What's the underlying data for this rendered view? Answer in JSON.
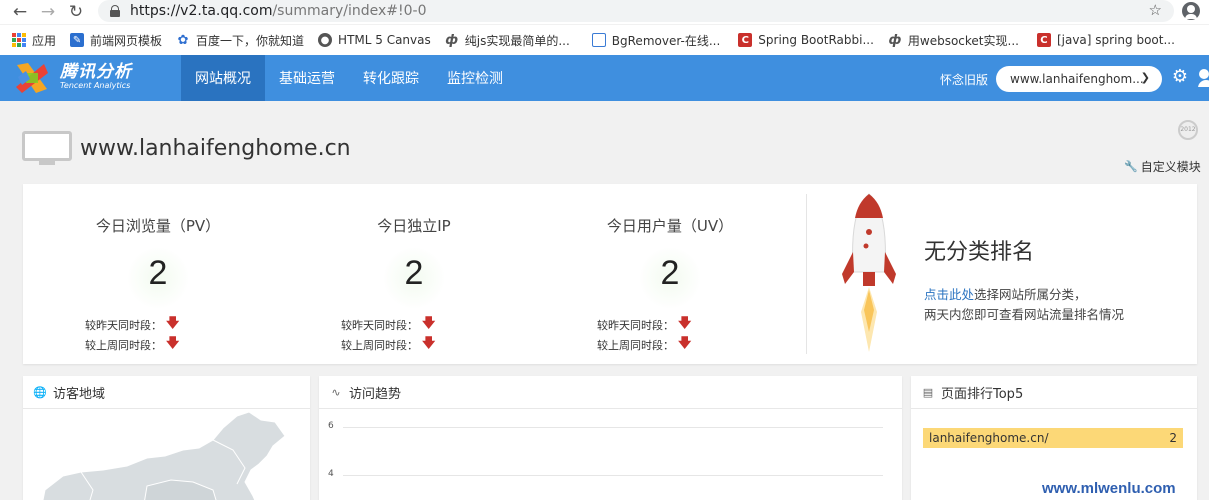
{
  "browser": {
    "url_main": "https://v2.ta.qq.com",
    "url_path": "/summary/index#!0-0",
    "bookmarks": [
      {
        "label": "应用",
        "icon": "apps-icon"
      },
      {
        "label": "前端网页模板",
        "icon": "page-icon"
      },
      {
        "label": "百度一下，你就知道",
        "icon": "baidu-paw-icon"
      },
      {
        "label": "HTML 5 Canvas",
        "icon": "globe-icon"
      },
      {
        "label": "纯js实现最简单的...",
        "icon": "v-icon"
      },
      {
        "label": "BgRemover-在线...",
        "icon": "box-icon"
      },
      {
        "label": "Spring BootRabbi...",
        "icon": "c-icon"
      },
      {
        "label": "用websocket实现...",
        "icon": "v-icon"
      },
      {
        "label": "[java] spring boot...",
        "icon": "c-icon"
      }
    ]
  },
  "header": {
    "logo_cn": "腾讯分析",
    "logo_en": "Tencent Analytics",
    "tabs": [
      {
        "label": "网站概况",
        "active": true
      },
      {
        "label": "基础运营",
        "active": false
      },
      {
        "label": "转化跟踪",
        "active": false
      },
      {
        "label": "监控检测",
        "active": false
      }
    ],
    "old_version_link": "怀念旧版",
    "site_select": "www.lanhaifenghom...",
    "accent_color": "#3f8fdf"
  },
  "site": {
    "name": "www.lanhaifenghome.cn",
    "custom_module": "自定义模块"
  },
  "stats": [
    {
      "label": "今日浏览量（PV）",
      "value": "2",
      "compare_yesterday": "较昨天同时段：",
      "compare_lastweek": "较上周同时段："
    },
    {
      "label": "今日独立IP",
      "value": "2",
      "compare_yesterday": "较昨天同时段：",
      "compare_lastweek": "较上周同时段："
    },
    {
      "label": "今日用户量（UV）",
      "value": "2",
      "compare_yesterday": "较昨天同时段：",
      "compare_lastweek": "较上周同时段："
    }
  ],
  "ranking": {
    "title": "无分类排名",
    "link_text": "点击此处",
    "desc_line1": "选择网站所属分类，",
    "desc_line2": "两天内您即可查看网站流量排名情况"
  },
  "panels": {
    "visitors_title": "访客地域",
    "trend_title": "访问趋势",
    "trend_y_ticks": [
      "6",
      "4"
    ],
    "top5_title": "页面排行Top5",
    "top5_rows": [
      {
        "page": "lanhaifenghome.cn/",
        "count": "2"
      }
    ]
  },
  "watermark": "www.mlwenlu.com"
}
